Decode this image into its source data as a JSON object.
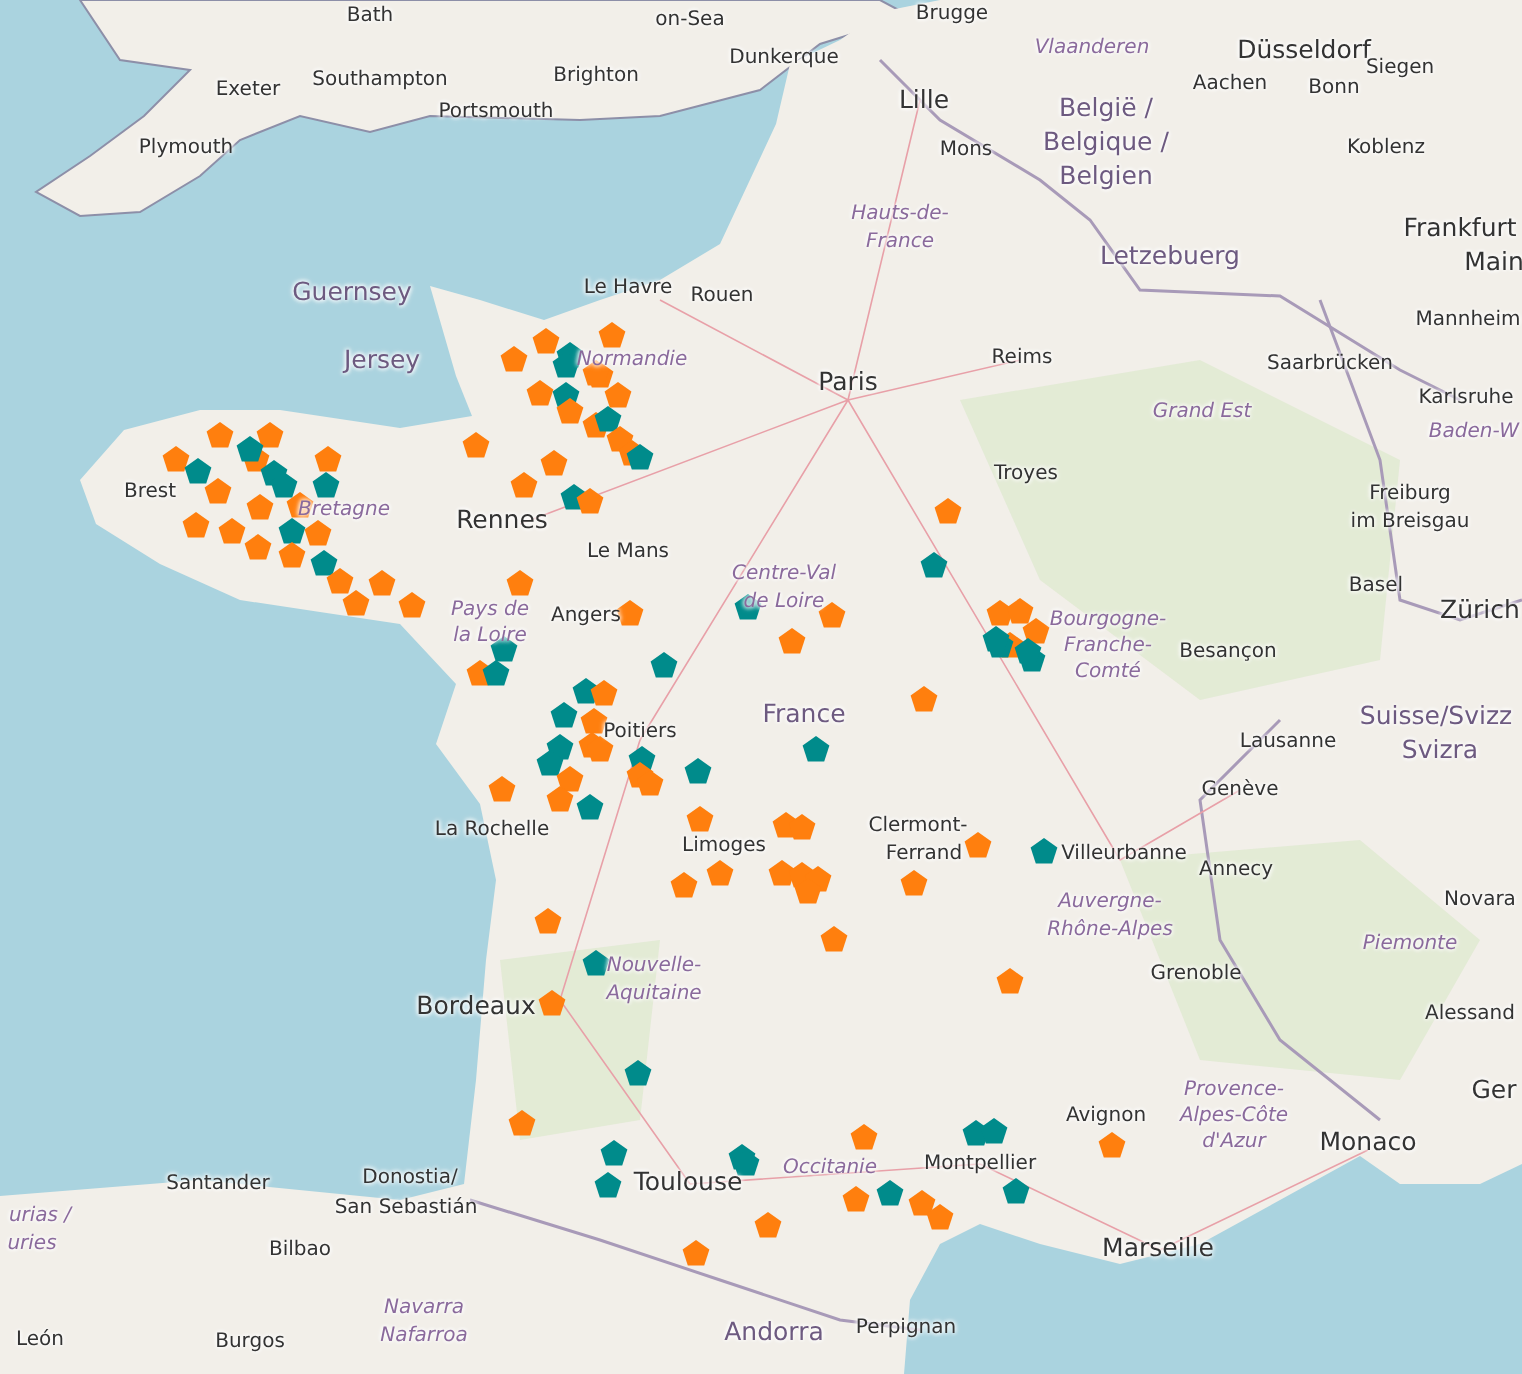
{
  "map": {
    "labels": [
      {
        "text": "Bath",
        "kind": "city"
      },
      {
        "text": "on-Sea",
        "kind": "city"
      },
      {
        "text": "Exeter",
        "kind": "city"
      },
      {
        "text": "Southampton",
        "kind": "city"
      },
      {
        "text": "Brighton",
        "kind": "city"
      },
      {
        "text": "Portsmouth",
        "kind": "city"
      },
      {
        "text": "Plymouth",
        "kind": "city"
      },
      {
        "text": "Dunkerque",
        "kind": "city"
      },
      {
        "text": "Brugge",
        "kind": "city"
      },
      {
        "text": "Vlaanderen",
        "kind": "region"
      },
      {
        "text": "Düsseldorf",
        "kind": "big"
      },
      {
        "text": "Aachen",
        "kind": "city"
      },
      {
        "text": "Bonn",
        "kind": "city"
      },
      {
        "text": "Siegen",
        "kind": "city"
      },
      {
        "text": "Lille",
        "kind": "big"
      },
      {
        "text": "Mons",
        "kind": "city"
      },
      {
        "text": "België /",
        "kind": "country"
      },
      {
        "text": "Belgique /",
        "kind": "country"
      },
      {
        "text": "Belgien",
        "kind": "country"
      },
      {
        "text": "Koblenz",
        "kind": "city"
      },
      {
        "text": "Frankfurt",
        "kind": "big"
      },
      {
        "text": "Main",
        "kind": "big"
      },
      {
        "text": "Letzebuerg",
        "kind": "country"
      },
      {
        "text": "Mannheim",
        "kind": "city"
      },
      {
        "text": "Hauts-de-",
        "kind": "region"
      },
      {
        "text": "France",
        "kind": "region"
      },
      {
        "text": "Guernsey",
        "kind": "country"
      },
      {
        "text": "Jersey",
        "kind": "country"
      },
      {
        "text": "Le Havre",
        "kind": "city"
      },
      {
        "text": "Rouen",
        "kind": "city"
      },
      {
        "text": "Paris",
        "kind": "big"
      },
      {
        "text": "Reims",
        "kind": "city"
      },
      {
        "text": "Saarbrücken",
        "kind": "city"
      },
      {
        "text": "Karlsruhe",
        "kind": "city"
      },
      {
        "text": "Grand Est",
        "kind": "region"
      },
      {
        "text": "Baden-W",
        "kind": "region"
      },
      {
        "text": "Normandie",
        "kind": "region"
      },
      {
        "text": "Brest",
        "kind": "city"
      },
      {
        "text": "Bretagne",
        "kind": "region"
      },
      {
        "text": "Rennes",
        "kind": "big"
      },
      {
        "text": "Le Mans",
        "kind": "city"
      },
      {
        "text": "Troyes",
        "kind": "city"
      },
      {
        "text": "Freiburg",
        "kind": "city"
      },
      {
        "text": "im Breisgau",
        "kind": "city"
      },
      {
        "text": "Pays de",
        "kind": "region"
      },
      {
        "text": "la Loire",
        "kind": "region"
      },
      {
        "text": "Angers",
        "kind": "city"
      },
      {
        "text": "Centre-Val",
        "kind": "region"
      },
      {
        "text": "de Loire",
        "kind": "region"
      },
      {
        "text": "Basel",
        "kind": "city"
      },
      {
        "text": "Zürich",
        "kind": "big"
      },
      {
        "text": "Bourgogne-",
        "kind": "region"
      },
      {
        "text": "Franche-",
        "kind": "region"
      },
      {
        "text": "Comté",
        "kind": "region"
      },
      {
        "text": "Besançon",
        "kind": "city"
      },
      {
        "text": "France",
        "kind": "country"
      },
      {
        "text": "Poitiers",
        "kind": "city"
      },
      {
        "text": "Suisse/Svizz",
        "kind": "country"
      },
      {
        "text": "Svizra",
        "kind": "country"
      },
      {
        "text": "Lausanne",
        "kind": "city"
      },
      {
        "text": "Genève",
        "kind": "city"
      },
      {
        "text": "La Rochelle",
        "kind": "city"
      },
      {
        "text": "Limoges",
        "kind": "city"
      },
      {
        "text": "Clermont-",
        "kind": "city"
      },
      {
        "text": "Ferrand",
        "kind": "city"
      },
      {
        "text": "Villeurbanne",
        "kind": "city"
      },
      {
        "text": "Annecy",
        "kind": "city"
      },
      {
        "text": "Auvergne-",
        "kind": "region"
      },
      {
        "text": "Rhône-Alpes",
        "kind": "region"
      },
      {
        "text": "Novara",
        "kind": "city"
      },
      {
        "text": "Piemonte",
        "kind": "region"
      },
      {
        "text": "Grenoble",
        "kind": "city"
      },
      {
        "text": "Alessand",
        "kind": "city"
      },
      {
        "text": "Nouvelle-",
        "kind": "region"
      },
      {
        "text": "Aquitaine",
        "kind": "region"
      },
      {
        "text": "Bordeaux",
        "kind": "big"
      },
      {
        "text": "Provence-",
        "kind": "region"
      },
      {
        "text": "Alpes-Côte",
        "kind": "region"
      },
      {
        "text": "d'Azur",
        "kind": "region"
      },
      {
        "text": "Avignon",
        "kind": "city"
      },
      {
        "text": "Monaco",
        "kind": "big"
      },
      {
        "text": "Ger",
        "kind": "big"
      },
      {
        "text": "Santander",
        "kind": "city"
      },
      {
        "text": "Donostia/",
        "kind": "city"
      },
      {
        "text": "San Sebastián",
        "kind": "city"
      },
      {
        "text": "Bilbao",
        "kind": "city"
      },
      {
        "text": "urias /",
        "kind": "region"
      },
      {
        "text": "uries",
        "kind": "region"
      },
      {
        "text": "Toulouse",
        "kind": "big"
      },
      {
        "text": "Occitanie",
        "kind": "region"
      },
      {
        "text": "Montpellier",
        "kind": "city"
      },
      {
        "text": "Marseille",
        "kind": "big"
      },
      {
        "text": "León",
        "kind": "city"
      },
      {
        "text": "Burgos",
        "kind": "city"
      },
      {
        "text": "Navarra",
        "kind": "region"
      },
      {
        "text": "Nafarroa",
        "kind": "region"
      },
      {
        "text": "Andorra",
        "kind": "country"
      },
      {
        "text": "Perpignan",
        "kind": "city"
      }
    ],
    "markers": [
      {
        "color": "#ff7f0e"
      },
      {
        "color": "#ff7f0e"
      },
      {
        "color": "#008b8b"
      },
      {
        "color": "#008b8b"
      },
      {
        "color": "#ff7f0e"
      },
      {
        "color": "#ff7f0e"
      },
      {
        "color": "#ff7f0e"
      },
      {
        "color": "#008b8b"
      },
      {
        "color": "#ff7f0e"
      },
      {
        "color": "#ff7f0e"
      },
      {
        "color": "#008b8b"
      },
      {
        "color": "#ff7f0e"
      },
      {
        "color": "#ff7f0e"
      },
      {
        "color": "#008b8b"
      },
      {
        "color": "#ff7f0e"
      },
      {
        "color": "#ff7f0e"
      },
      {
        "color": "#ff7f0e"
      },
      {
        "color": "#ff7f0e"
      },
      {
        "color": "#008b8b"
      },
      {
        "color": "#ff7f0e"
      },
      {
        "color": "#ff7f0e"
      },
      {
        "color": "#ff7f0e"
      },
      {
        "color": "#008b8b"
      },
      {
        "color": "#ff7f0e"
      },
      {
        "color": "#ff7f0e"
      },
      {
        "color": "#ff7f0e"
      },
      {
        "color": "#008b8b"
      },
      {
        "color": "#008b8b"
      },
      {
        "color": "#008b8b"
      },
      {
        "color": "#ff7f0e"
      },
      {
        "color": "#ff7f0e"
      },
      {
        "color": "#ff7f0e"
      },
      {
        "color": "#ff7f0e"
      },
      {
        "color": "#ff7f0e"
      },
      {
        "color": "#008b8b"
      },
      {
        "color": "#ff7f0e"
      },
      {
        "color": "#ff7f0e"
      },
      {
        "color": "#ff7f0e"
      },
      {
        "color": "#008b8b"
      },
      {
        "color": "#ff7f0e"
      },
      {
        "color": "#008b8b"
      },
      {
        "color": "#ff7f0e"
      },
      {
        "color": "#ff7f0e"
      },
      {
        "color": "#ff7f0e"
      },
      {
        "color": "#ff7f0e"
      },
      {
        "color": "#ff7f0e"
      },
      {
        "color": "#008b8b"
      },
      {
        "color": "#ff7f0e"
      },
      {
        "color": "#008b8b"
      },
      {
        "color": "#008b8b"
      },
      {
        "color": "#ff7f0e"
      },
      {
        "color": "#008b8b"
      },
      {
        "color": "#ff7f0e"
      },
      {
        "color": "#ff7f0e"
      },
      {
        "color": "#ff7f0e"
      },
      {
        "color": "#008b8b"
      },
      {
        "color": "#008b8b"
      },
      {
        "color": "#ff7f0e"
      },
      {
        "color": "#ff7f0e"
      },
      {
        "color": "#ff7f0e"
      },
      {
        "color": "#008b8b"
      },
      {
        "color": "#008b8b"
      },
      {
        "color": "#008b8b"
      },
      {
        "color": "#008b8b"
      },
      {
        "color": "#008b8b"
      },
      {
        "color": "#ff7f0e"
      },
      {
        "color": "#ff7f0e"
      },
      {
        "color": "#ff7f0e"
      },
      {
        "color": "#008b8b"
      },
      {
        "color": "#ff7f0e"
      },
      {
        "color": "#ff7f0e"
      },
      {
        "color": "#ff7f0e"
      },
      {
        "color": "#ff7f0e"
      },
      {
        "color": "#ff7f0e"
      },
      {
        "color": "#ff7f0e"
      },
      {
        "color": "#ff7f0e"
      },
      {
        "color": "#ff7f0e"
      },
      {
        "color": "#ff7f0e"
      },
      {
        "color": "#ff7f0e"
      },
      {
        "color": "#ff7f0e"
      },
      {
        "color": "#ff7f0e"
      },
      {
        "color": "#ff7f0e"
      },
      {
        "color": "#ff7f0e"
      },
      {
        "color": "#008b8b"
      },
      {
        "color": "#ff7f0e"
      },
      {
        "color": "#ff7f0e"
      },
      {
        "color": "#ff7f0e"
      },
      {
        "color": "#008b8b"
      },
      {
        "color": "#ff7f0e"
      },
      {
        "color": "#008b8b"
      },
      {
        "color": "#ff7f0e"
      },
      {
        "color": "#008b8b"
      },
      {
        "color": "#008b8b"
      },
      {
        "color": "#008b8b"
      },
      {
        "color": "#008b8b"
      },
      {
        "color": "#ff7f0e"
      },
      {
        "color": "#ff7f0e"
      },
      {
        "color": "#ff7f0e"
      },
      {
        "color": "#008b8b"
      },
      {
        "color": "#ff7f0e"
      },
      {
        "color": "#ff7f0e"
      },
      {
        "color": "#ff7f0e"
      },
      {
        "color": "#008b8b"
      },
      {
        "color": "#008b8b"
      },
      {
        "color": "#008b8b"
      },
      {
        "color": "#ff7f0e"
      },
      {
        "color": "#ff7f0e"
      },
      {
        "color": "#ff7f0e"
      },
      {
        "color": "#ff7f0e"
      },
      {
        "color": "#ff7f0e"
      },
      {
        "color": "#008b8b"
      },
      {
        "color": "#008b8b"
      },
      {
        "color": "#008b8b"
      },
      {
        "color": "#008b8b"
      },
      {
        "color": "#ff7f0e"
      },
      {
        "color": "#008b8b"
      }
    ]
  }
}
